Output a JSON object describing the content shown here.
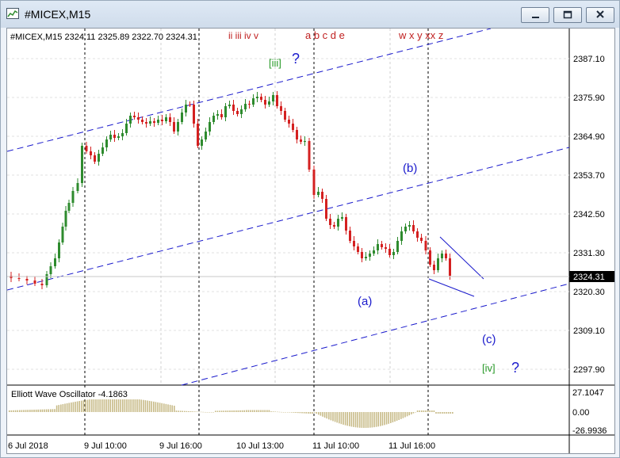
{
  "window": {
    "title": "#MICEX,M15",
    "buttons": [
      "minimize",
      "maximize",
      "close"
    ]
  },
  "chart": {
    "symbol_line": "#MICEX,M15  2324.11 2325.89 2322.70 2324.31",
    "price_axis": [
      "2387.10",
      "2375.90",
      "2364.90",
      "2353.70",
      "2342.50",
      "2331.30",
      "2320.30",
      "2309.10",
      "2297.90"
    ],
    "current_price": "2324.31",
    "time_axis": [
      "6 Jul 2018",
      "9 Jul 10:00",
      "9 Jul 16:00",
      "10 Jul 13:00",
      "11 Jul 10:00",
      "11 Jul 16:00"
    ],
    "wave_labels": {
      "top_1": "ii iii iv v",
      "top_2": "a b c d e",
      "top_3": "w x y xx z",
      "iii": "[iii]",
      "iii_q": "?",
      "b": "(b)",
      "a": "(a)",
      "c": "(c)",
      "iv": "[iv]",
      "iv_q": "?"
    },
    "colors": {
      "up": "#2e8b2e",
      "down": "#d42020",
      "channel": "#1a1acc",
      "osc": "#c8bb88"
    }
  },
  "oscillator": {
    "title": "Elliott Wave Oscillator -4.1863",
    "axis": [
      "27.1047",
      "0.00",
      "-26.9936"
    ]
  }
}
